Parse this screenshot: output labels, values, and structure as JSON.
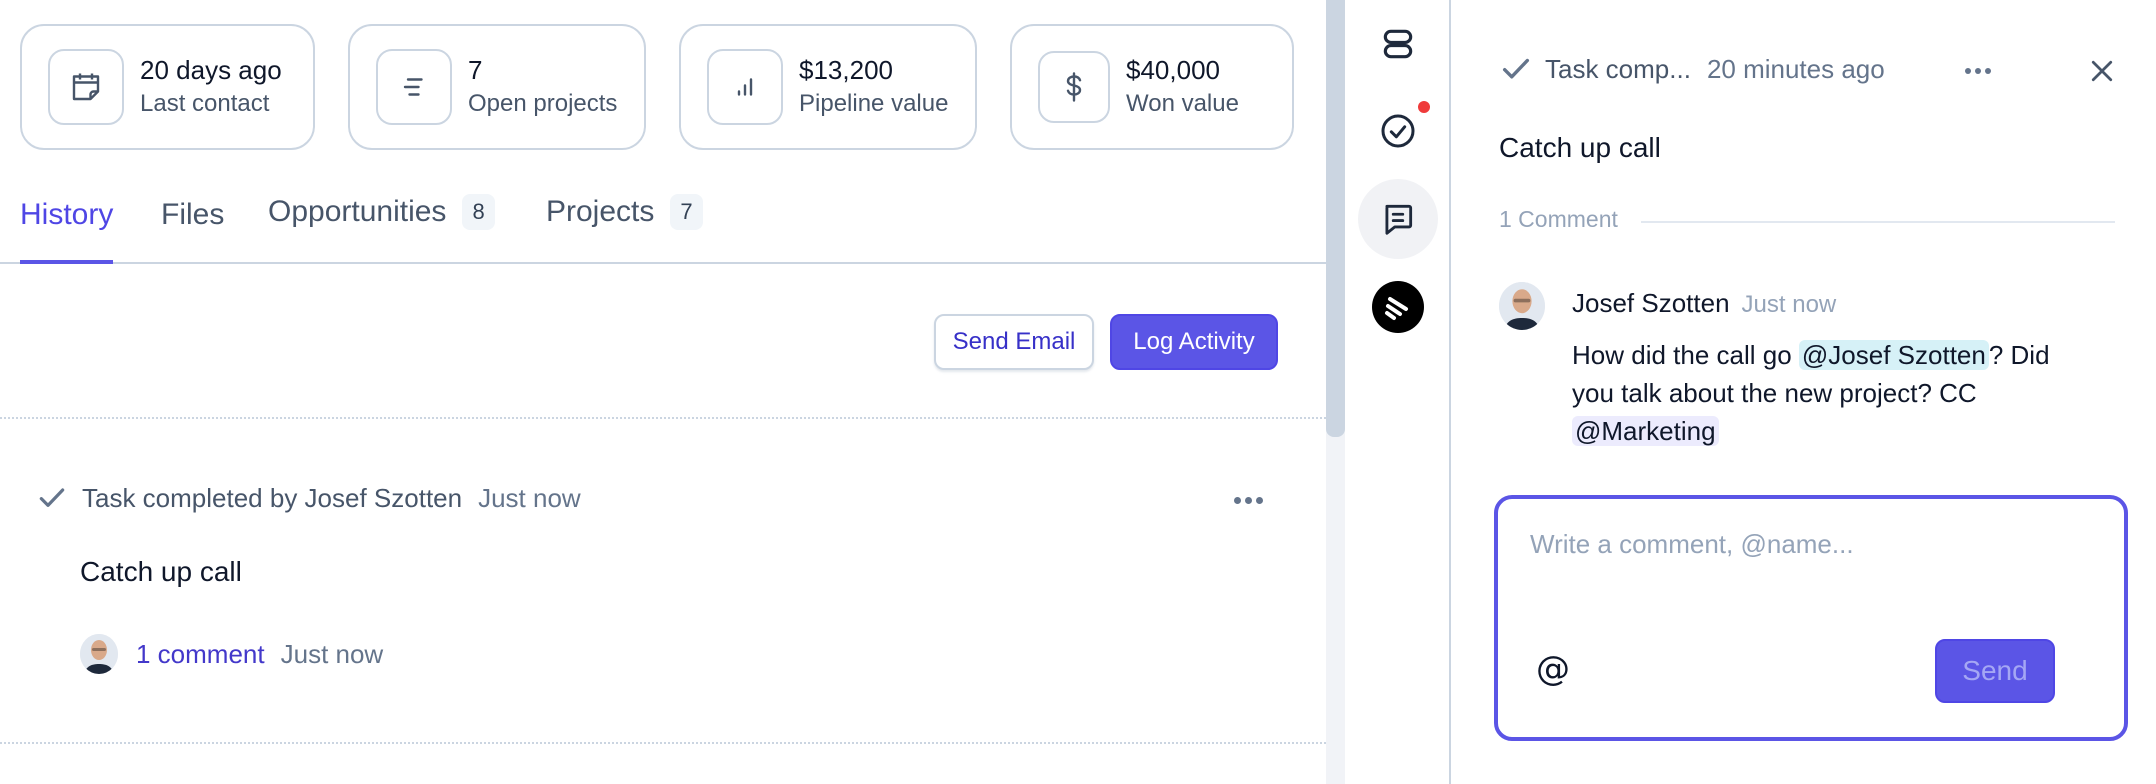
{
  "stats": [
    {
      "icon": "calendar-icon",
      "value": "20 days ago",
      "label": "Last contact"
    },
    {
      "icon": "list-icon",
      "value": "7",
      "label": "Open projects"
    },
    {
      "icon": "bar-chart-icon",
      "value": "$13,200",
      "label": "Pipeline value"
    },
    {
      "icon": "dollar-icon",
      "value": "$40,000",
      "label": "Won value"
    }
  ],
  "tabs": [
    {
      "label": "History",
      "active": true
    },
    {
      "label": "Files"
    },
    {
      "label": "Opportunities",
      "badge": "8"
    },
    {
      "label": "Projects",
      "badge": "7"
    }
  ],
  "actions": {
    "send_email": "Send Email",
    "log_activity": "Log Activity"
  },
  "activity": {
    "header": "Task completed by Josef Szotten",
    "time": "Just now",
    "title": "Catch up call",
    "comment_link": "1 comment",
    "comment_time": "Just now"
  },
  "rail": {
    "items": [
      "layout-icon",
      "task-check-icon",
      "comment-icon",
      "app-logo-icon"
    ],
    "notification_color": "#ef3b3b"
  },
  "panel": {
    "header": "Task comp...",
    "header_time": "20 minutes ago",
    "title": "Catch up call",
    "comment_count": "1 Comment",
    "comment": {
      "author": "Josef Szotten",
      "time": "Just now",
      "text_1": "How did the call go ",
      "mention_1": "@Josef Szotten",
      "text_2": "? Did you talk about the new project? CC ",
      "mention_2": "@Marketing"
    },
    "composer": {
      "placeholder": "Write a comment, @name...",
      "value": "",
      "mention_button": "@",
      "send_label": "Send"
    }
  },
  "colors": {
    "accent": "#5b55e6",
    "link": "#4338ca",
    "border": "#cbd5e1"
  }
}
